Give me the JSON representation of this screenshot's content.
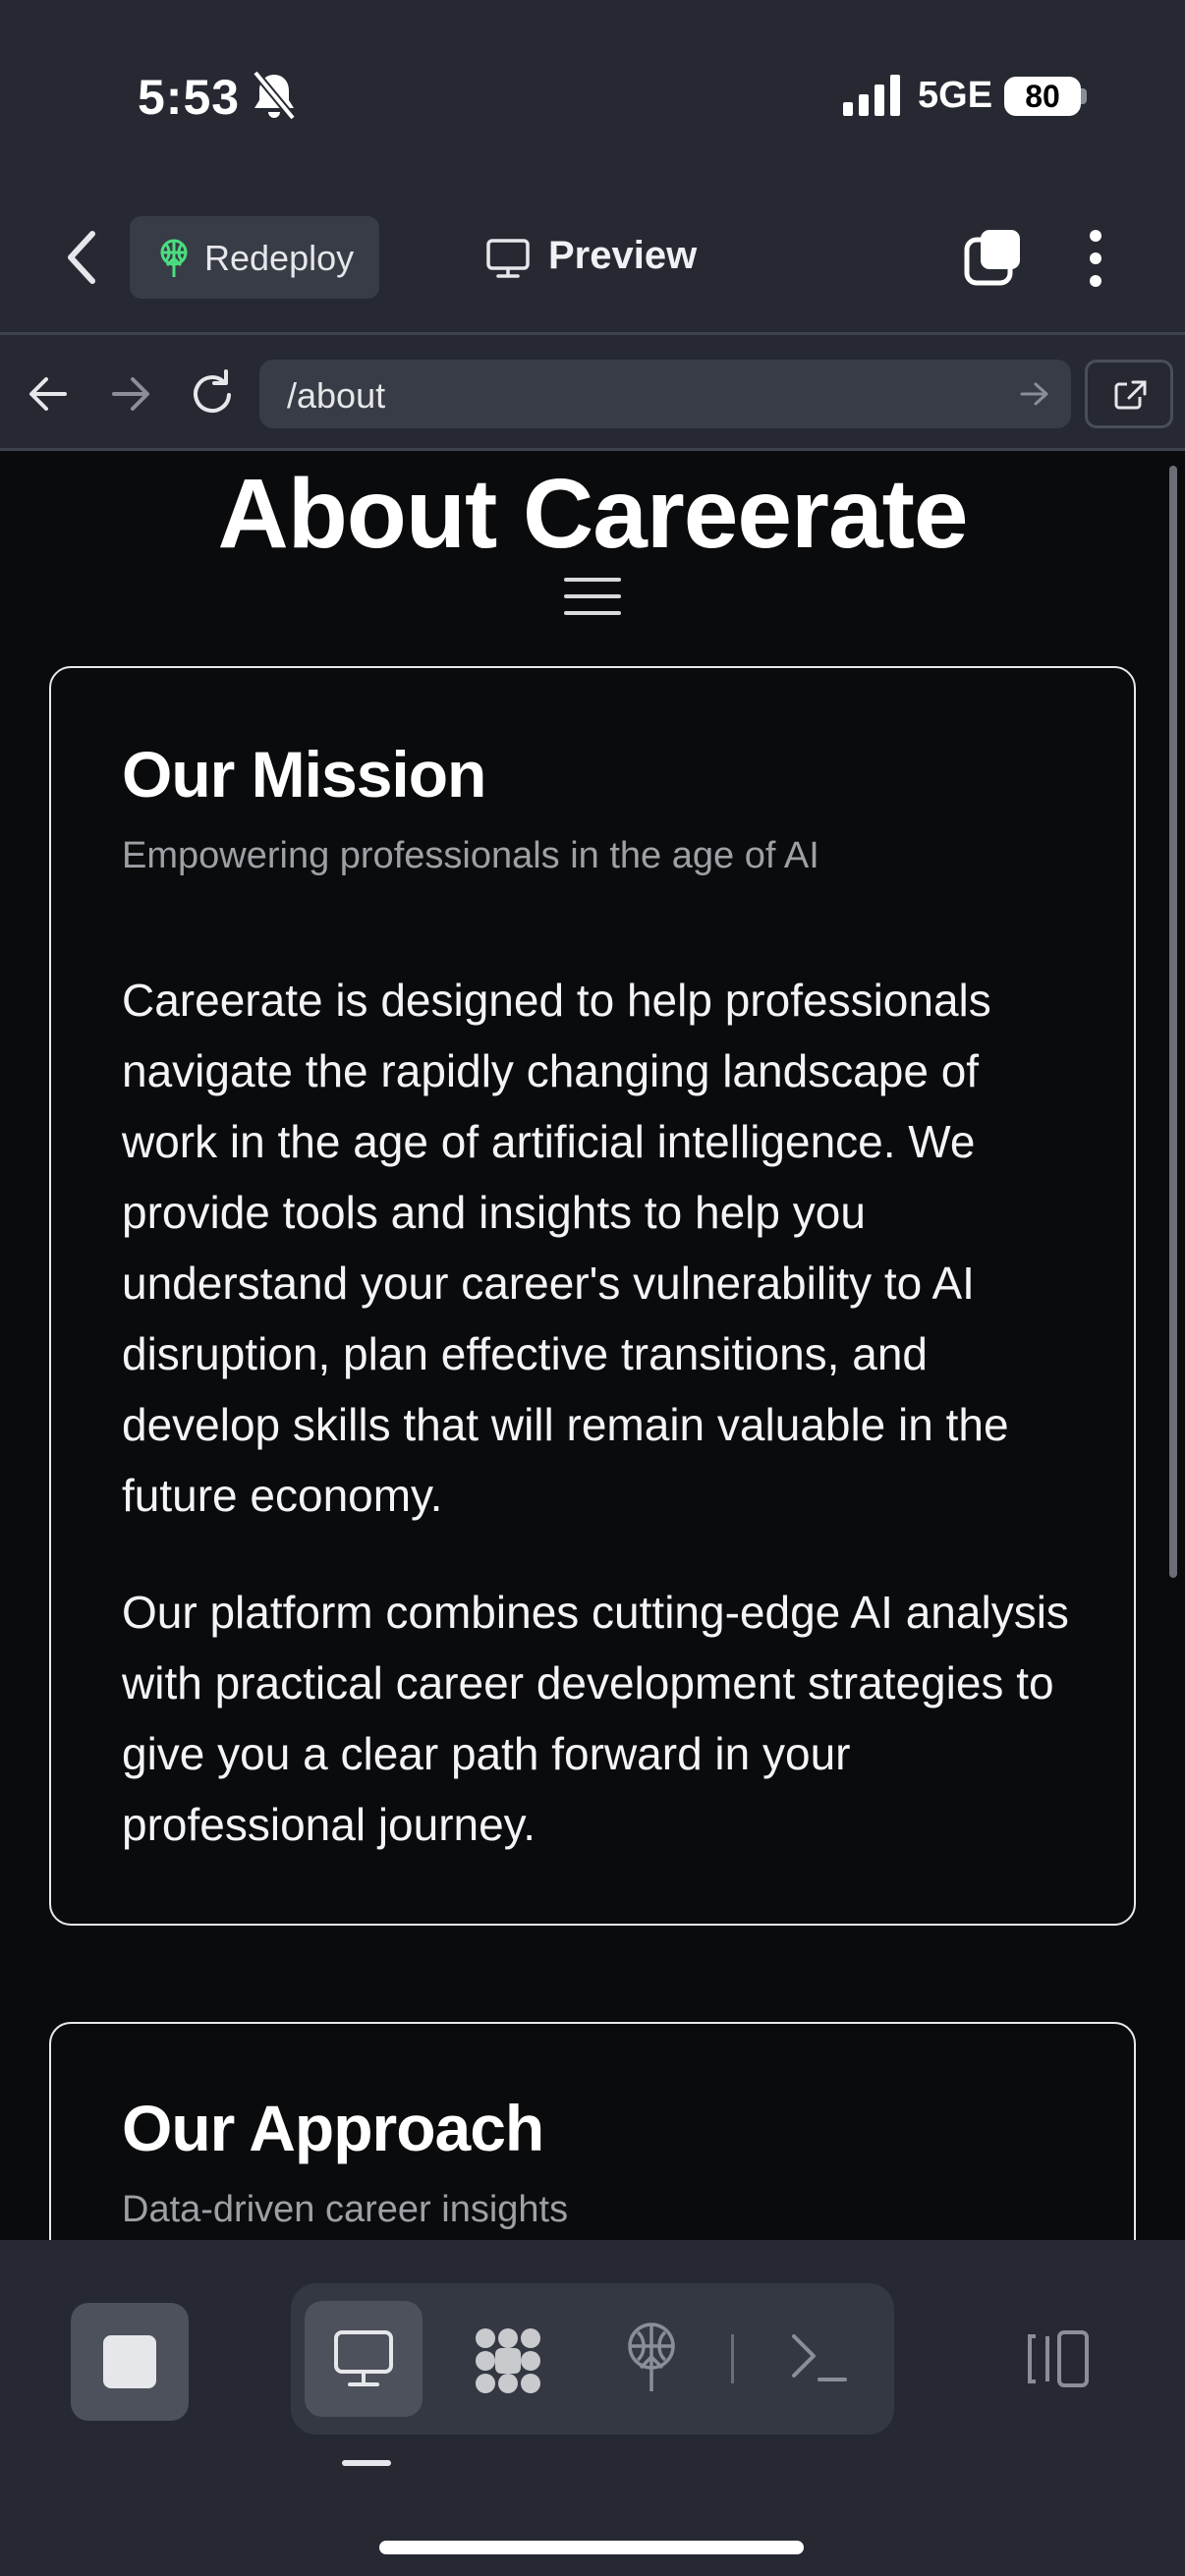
{
  "status_bar": {
    "time": "5:53",
    "network": "5GE",
    "battery": "80",
    "icons": [
      "bell-muted-icon",
      "signal-icon"
    ]
  },
  "app_header": {
    "redeploy_label": "Redeploy",
    "preview_label": "Preview",
    "icons": [
      "back-icon",
      "redeploy-icon",
      "preview-monitor-icon",
      "tabs-icon",
      "more-vertical-icon"
    ],
    "accent_color": "#4ade80"
  },
  "url_bar": {
    "path": "/about",
    "icons": [
      "nav-back-icon",
      "nav-forward-icon",
      "reload-icon",
      "go-arrow-icon",
      "open-external-icon"
    ]
  },
  "page": {
    "title": "About Careerate",
    "menu_icon": "hamburger-icon",
    "cards": [
      {
        "title": "Our Mission",
        "subtitle": "Empowering professionals in the age of AI",
        "paragraphs": [
          "Careerate is designed to help professionals navigate the rapidly changing landscape of work in the age of artificial intelligence. We provide tools and insights to help you understand your career's vulnerability to AI disruption, plan effective transitions, and develop skills that will remain valuable in the future economy.",
          "Our platform combines cutting-edge AI analysis with practical career development strategies to give you a clear path forward in your professional journey."
        ]
      },
      {
        "title": "Our Approach",
        "subtitle": "Data-driven career insights"
      }
    ]
  },
  "bottom_toolbar": {
    "icons": [
      "stop-icon",
      "monitor-icon",
      "packages-icon",
      "deploy-icon",
      "terminal-icon",
      "panel-toggle-icon"
    ]
  }
}
